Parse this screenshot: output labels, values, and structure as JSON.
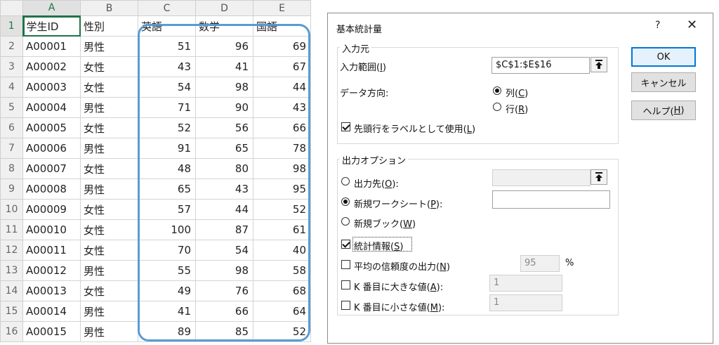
{
  "sheet": {
    "columns": [
      "A",
      "B",
      "C",
      "D",
      "E"
    ],
    "rows": [
      {
        "n": "1",
        "cells": [
          "学生ID",
          "性別",
          "英語",
          "数学",
          "国語"
        ]
      },
      {
        "n": "2",
        "cells": [
          "A00001",
          "男性",
          "51",
          "96",
          "69"
        ]
      },
      {
        "n": "3",
        "cells": [
          "A00002",
          "女性",
          "43",
          "41",
          "67"
        ]
      },
      {
        "n": "4",
        "cells": [
          "A00003",
          "女性",
          "54",
          "98",
          "44"
        ]
      },
      {
        "n": "5",
        "cells": [
          "A00004",
          "男性",
          "71",
          "90",
          "43"
        ]
      },
      {
        "n": "6",
        "cells": [
          "A00005",
          "女性",
          "52",
          "56",
          "66"
        ]
      },
      {
        "n": "7",
        "cells": [
          "A00006",
          "男性",
          "91",
          "65",
          "78"
        ]
      },
      {
        "n": "8",
        "cells": [
          "A00007",
          "女性",
          "48",
          "80",
          "98"
        ]
      },
      {
        "n": "9",
        "cells": [
          "A00008",
          "男性",
          "65",
          "43",
          "95"
        ]
      },
      {
        "n": "10",
        "cells": [
          "A00009",
          "女性",
          "57",
          "44",
          "52"
        ]
      },
      {
        "n": "11",
        "cells": [
          "A00010",
          "女性",
          "100",
          "87",
          "61"
        ]
      },
      {
        "n": "12",
        "cells": [
          "A00011",
          "女性",
          "70",
          "54",
          "40"
        ]
      },
      {
        "n": "13",
        "cells": [
          "A00012",
          "男性",
          "55",
          "98",
          "58"
        ]
      },
      {
        "n": "14",
        "cells": [
          "A00013",
          "女性",
          "49",
          "76",
          "68"
        ]
      },
      {
        "n": "15",
        "cells": [
          "A00014",
          "男性",
          "41",
          "66",
          "64"
        ]
      },
      {
        "n": "16",
        "cells": [
          "A00015",
          "男性",
          "89",
          "85",
          "52"
        ]
      }
    ],
    "highlight_color": "#5b9bd5",
    "selection_color": "#217346"
  },
  "dialog": {
    "title": "基本統計量",
    "help_glyph": "?",
    "close_glyph": "✕",
    "input_group": {
      "title": "入力元",
      "range_label": "入力範囲(",
      "range_key": "I",
      "range_value": "$C$1:$E$16",
      "direction_label": "データ方向:",
      "col_label": "列(",
      "col_key": "C",
      "row_label": "行(",
      "row_key": "R",
      "labels_first_row": "先頭行をラベルとして使用(",
      "labels_key": "L"
    },
    "output_group": {
      "title": "出力オプション",
      "output_range_label": "出力先(",
      "output_range_key": "O",
      "new_sheet_label": "新規ワークシート(",
      "new_sheet_key": "P",
      "new_book_label": "新規ブック(",
      "new_book_key": "W",
      "summary_label": "統計情報(",
      "summary_key": "S",
      "confidence_label": "平均の信頼度の出力(",
      "confidence_key": "N",
      "confidence_value": "95",
      "percent": "%",
      "kth_largest_label": "K 番目に大きな値(",
      "kth_largest_key": "A",
      "kth_largest_value": "1",
      "kth_smallest_label": "K 番目に小さな値(",
      "kth_smallest_key": "M",
      "kth_smallest_value": "1"
    },
    "buttons": {
      "ok": "OK",
      "cancel": "キャンセル",
      "help_prefix": "ヘルプ(",
      "help_key": "H"
    },
    "close_paren": "):",
    "close_paren_plain": ")",
    "ref_icon": "⭱"
  }
}
